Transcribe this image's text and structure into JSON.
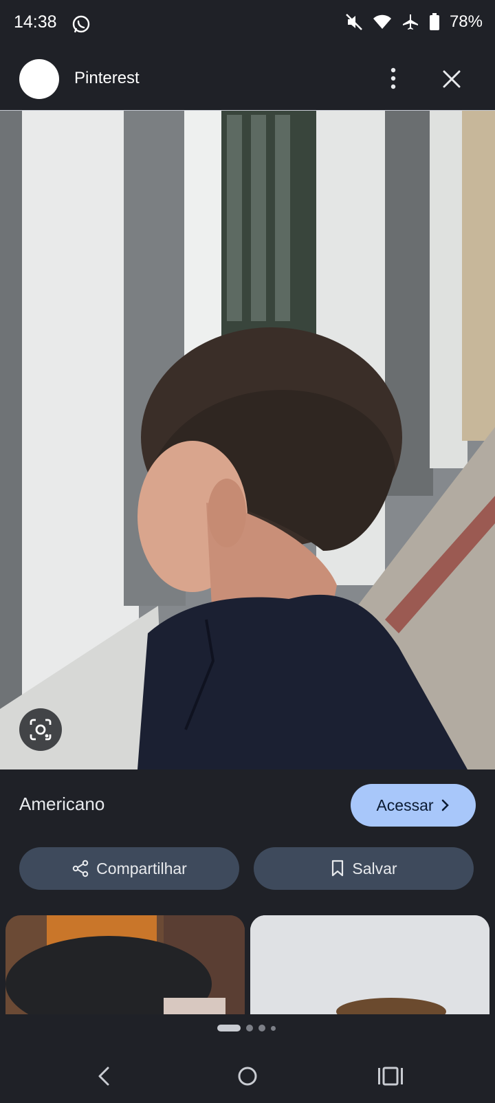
{
  "status_bar": {
    "time": "14:38",
    "battery_percent": "78%",
    "icons": [
      "whatsapp-icon",
      "mute-icon",
      "wifi-icon",
      "airplane-icon",
      "battery-icon"
    ]
  },
  "header": {
    "site_name": "Pinterest",
    "icons": [
      "more-vert-icon",
      "close-icon"
    ]
  },
  "result": {
    "title": "Americano",
    "visit_label": "Acessar",
    "share_label": "Compartilhar",
    "save_label": "Salvar"
  },
  "pager": {
    "page_count": 4,
    "active_index": 0
  },
  "nav_bar": {
    "icons": [
      "back-icon",
      "home-icon",
      "recents-icon"
    ]
  },
  "colors": {
    "background": "#1f2127",
    "accent": "#a8c7fa",
    "pill": "#3e4a5c"
  }
}
